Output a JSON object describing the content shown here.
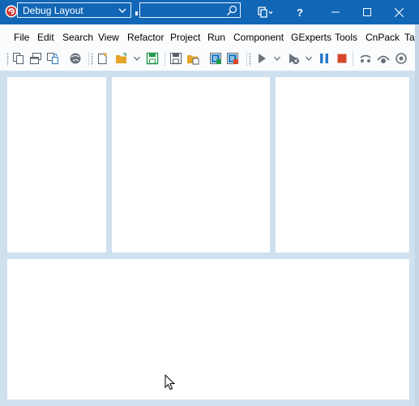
{
  "titlebar": {
    "layout_combo_value": "Debug Layout",
    "search_placeholder": "",
    "help_label": "?",
    "icons": [
      "app-logo",
      "chevron-down-icon",
      "search-icon",
      "layouts-icon",
      "minimize-icon",
      "maximize-icon",
      "close-icon"
    ]
  },
  "menu": {
    "items": [
      "File",
      "Edit",
      "Search",
      "View",
      "Refactor",
      "Project",
      "Run",
      "Component",
      "GExperts",
      "Tools",
      "CnPack",
      "Tal"
    ]
  },
  "toolbar": {
    "icons": [
      "copy-icon",
      "window-list-icon",
      "toggle-form-unit-icon",
      "globe-icon",
      "new-file-icon",
      "open-folder-icon",
      "save-icon",
      "save-all-icon",
      "open-project-icon",
      "add-to-project-icon",
      "remove-from-project-icon",
      "run-icon",
      "run-without-debug-icon",
      "pause-icon",
      "stop-icon",
      "step-over-icon",
      "trace-into-icon",
      "run-to-cursor-icon"
    ]
  },
  "colors": {
    "titlebar": "#1166b5",
    "workspace": "#cfe0ef",
    "pane": "#ffffff",
    "stop": "#d9472b",
    "pause": "#2a79c7",
    "save": "#1f9a4a"
  }
}
